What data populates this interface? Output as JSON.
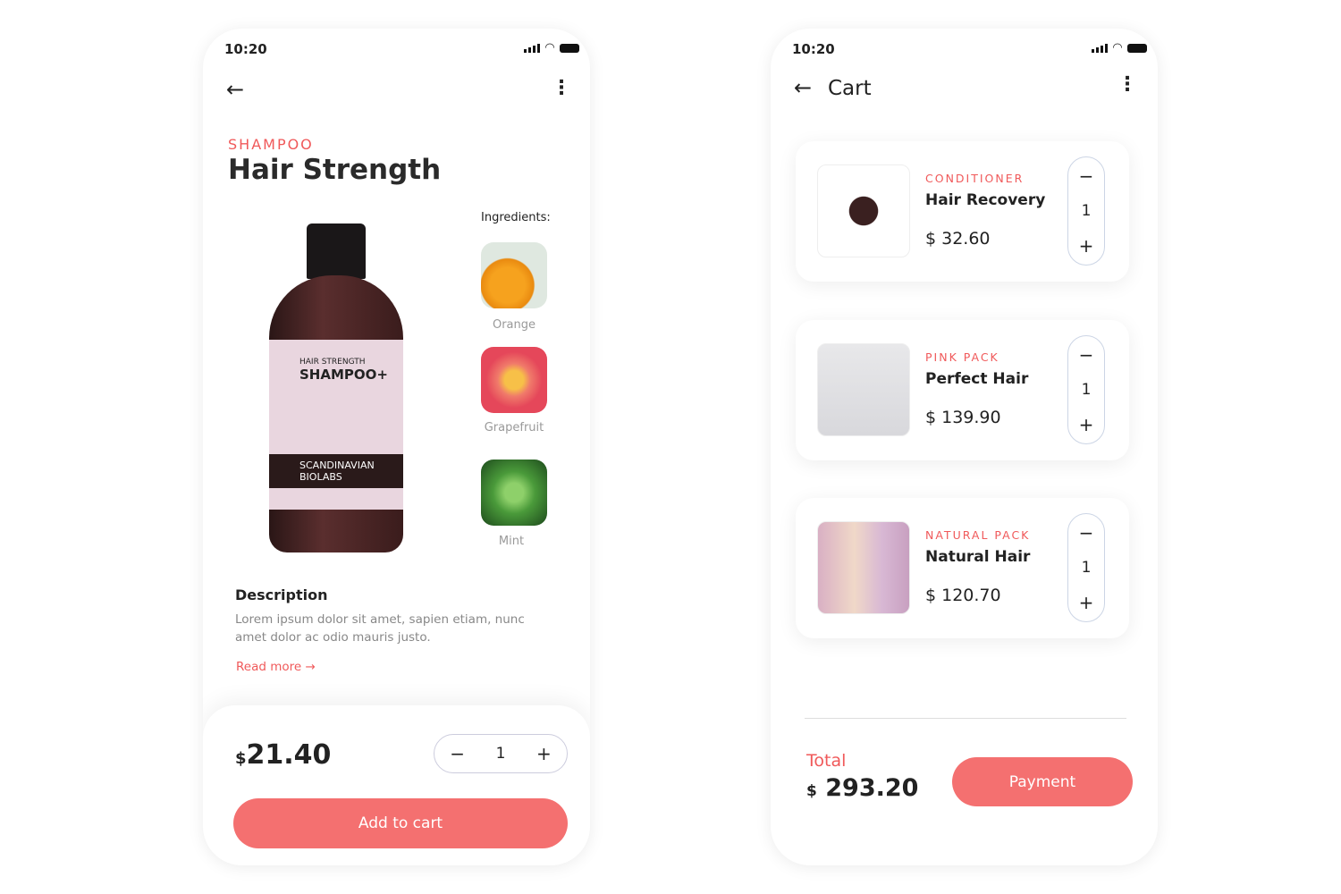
{
  "status": {
    "time": "10:20"
  },
  "product": {
    "category": "SHAMPOO",
    "title": "Hair Strength",
    "ingredients_label": "Ingredients:",
    "ingredients": [
      {
        "name": "Orange"
      },
      {
        "name": "Grapefruit"
      },
      {
        "name": "Mint"
      }
    ],
    "bottle_label": {
      "brand_line": "HAIR STRENGTH",
      "name": "SHAMPOO+",
      "brand": "SCANDINAVIAN BIOLABS"
    },
    "description_title": "Description",
    "description": "Lorem ipsum dolor sit amet, sapien etiam, nunc amet dolor ac odio mauris justo.",
    "read_more": "Read more",
    "currency": "$",
    "price": "21.40",
    "quantity": "1",
    "add_to_cart": "Add to cart"
  },
  "cart": {
    "title": "Cart",
    "items": [
      {
        "category": "CONDITIONER",
        "name": "Hair Recovery",
        "price": "$ 32.60",
        "quantity": "1"
      },
      {
        "category": "PINK PACK",
        "name": "Perfect Hair",
        "price": "$ 139.90",
        "quantity": "1"
      },
      {
        "category": "NATURAL PACK",
        "name": "Natural Hair",
        "price": "$ 120.70",
        "quantity": "1"
      }
    ],
    "total_label": "Total",
    "currency": "$",
    "total": "293.20",
    "payment": "Payment"
  },
  "colors": {
    "accent": "#f47070",
    "category": "#f0595a"
  }
}
